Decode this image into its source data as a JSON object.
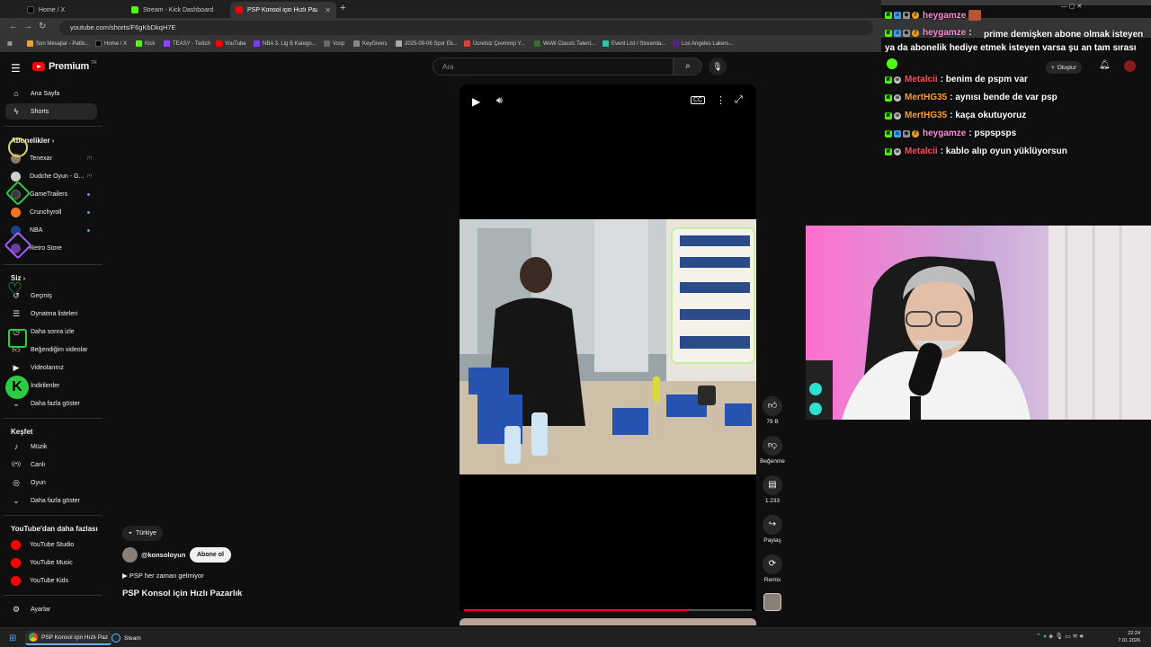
{
  "browser": {
    "tabs": [
      {
        "title": "Home / X",
        "favicon_color": "#000000"
      },
      {
        "title": "Stream - Kick Dashboard",
        "favicon_color": "#53fc18"
      },
      {
        "title": "PSP Konsol için Hızlı Pazarlık - Y",
        "favicon_color": "#ff0000"
      }
    ],
    "url": "youtube.com/shorts/F6gKbDkqH7E",
    "bookmarks": [
      "Son Mesajlar - Patlic...",
      "Home / X",
      "Kick",
      "TEASY - Twitch",
      "YouTube",
      "NBA 3. Lig B Katego...",
      "Vosp",
      "KeyGivers",
      "2025-09-06 Spor Ek...",
      "Ücretsiz Çevrimiçi Y...",
      "WoW Classic Talent...",
      "Event List / Streamla...",
      "Los Angeles Lakers..."
    ]
  },
  "masthead": {
    "logo_text": "Premium",
    "logo_region": "TR",
    "search_placeholder": "Ara",
    "create_label": "Oluştur"
  },
  "sidebar": {
    "main": [
      {
        "label": "Ana Sayfa",
        "icon": "home-icon",
        "glyph": "⌂"
      },
      {
        "label": "Shorts",
        "icon": "shorts-icon",
        "glyph": "▰"
      }
    ],
    "subscriptions_title": "Abonelikler",
    "subscriptions": [
      {
        "label": "Tenexar",
        "color": "#8d7b6a",
        "live": "(•)"
      },
      {
        "label": "Dudche Oyun - G...",
        "color": "#cfcfcf",
        "live": "(•)"
      },
      {
        "label": "GameTrailers",
        "color": "#3a3a3a",
        "dot": true
      },
      {
        "label": "Crunchyroll",
        "color": "#f47521",
        "dot": true
      },
      {
        "label": "NBA",
        "color": "#1d428a",
        "dot": true
      },
      {
        "label": "Retro Store",
        "color": "#6b3fa0"
      }
    ],
    "you_title": "Siz",
    "you": [
      {
        "label": "Geçmiş",
        "glyph": "↺"
      },
      {
        "label": "Oynatma listeleri",
        "glyph": "☰"
      },
      {
        "label": "Daha sonra izle",
        "glyph": "◷"
      },
      {
        "label": "Beğendiğim videolar",
        "glyph": "👍"
      },
      {
        "label": "Videolarınız",
        "glyph": "▶"
      },
      {
        "label": "İndirilenler",
        "glyph": "⤓"
      },
      {
        "label": "Daha fazla göster",
        "glyph": "⌄"
      }
    ],
    "explore_title": "Keşfet",
    "explore": [
      {
        "label": "Müzik",
        "glyph": "♪"
      },
      {
        "label": "Canlı",
        "glyph": "((•))"
      },
      {
        "label": "Oyun",
        "glyph": "◎"
      },
      {
        "label": "Daha fazla göster",
        "glyph": "⌄"
      }
    ],
    "more_title": "YouTube'dan daha fazlası",
    "more": [
      {
        "label": "YouTube Studio"
      },
      {
        "label": "YouTube Music"
      },
      {
        "label": "YouTube Kids"
      }
    ],
    "settings_label": "Ayarlar"
  },
  "short": {
    "location": "Türkiye",
    "channel": "@konsoloyun",
    "subscribe_label": "Abone ol",
    "music": "PSP her zaman gelmiyor",
    "title": "PSP Konsol için Hızlı Pazarlık",
    "likes": "79 B",
    "dislike_label": "Beğenme",
    "comments": "1.233",
    "share_label": "Paylaş",
    "remix_label": "Remix",
    "progress": 0.78
  },
  "chat": [
    {
      "user": "heygamze",
      "user_color": "#ff8fd8",
      "message": "prime demişken abone olmak isteyen ya da abonelik hediye etmek isteyen varsa şu an tam sırası",
      "multiline": true
    },
    {
      "user": "Metalcii",
      "user_color": "#ff4f4f",
      "message": "benim de pspm var"
    },
    {
      "user": "MertHG35",
      "user_color": "#ff9f2e",
      "message": "aynısı bende de var psp"
    },
    {
      "user": "MertHG35",
      "user_color": "#ff9f2e",
      "message": "kaça okutuyoruz"
    },
    {
      "user": "heygamze",
      "user_color": "#ff8fd8",
      "message": "pspspsps"
    },
    {
      "user": "Metalcii",
      "user_color": "#ff4f4f",
      "message": "kablo alıp oyun yüklüyorsun"
    }
  ],
  "taskbar": {
    "apps": [
      "PSP Konsol için Hızlı Paz",
      "Steam"
    ],
    "time": "22:24",
    "date": "7.01.2026"
  }
}
